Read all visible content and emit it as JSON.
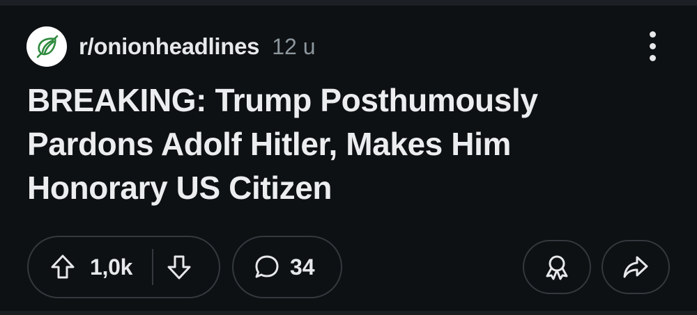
{
  "post": {
    "subreddit": "r/onionheadlines",
    "time_ago": "12 u",
    "title": "BREAKING: Trump Posthumously Pardons Adolf Hitler, Makes Him Honorary US Citizen",
    "score": "1,0k",
    "comment_count": "34"
  },
  "icons": {
    "avatar": "onion-logo-icon",
    "more": "more-options-icon",
    "upvote": "upvote-arrow-icon",
    "downvote": "downvote-arrow-icon",
    "comment": "comment-bubble-icon",
    "award": "award-icon",
    "share": "share-icon"
  },
  "colors": {
    "background": "#0e1113",
    "text_primary": "#e6e8ea",
    "text_secondary": "#8c979e",
    "pill_border": "#33393e",
    "onion_green": "#2f8a3d"
  }
}
